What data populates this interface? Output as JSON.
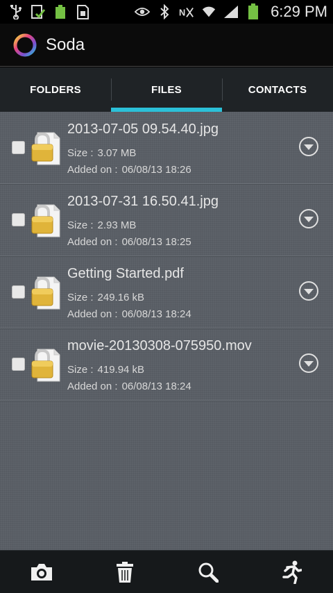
{
  "status_bar": {
    "time": "6:29 PM",
    "icons": [
      "usb-icon",
      "download-done-icon",
      "battery-app-icon",
      "sd-card-icon",
      "eye-icon",
      "bluetooth-icon",
      "no-signal-icon",
      "wifi-icon",
      "signal-icon",
      "battery-icon"
    ]
  },
  "app_bar": {
    "title": "Soda"
  },
  "tabs": [
    {
      "label": "FOLDERS"
    },
    {
      "label": "FILES"
    },
    {
      "label": "CONTACTS"
    }
  ],
  "labels": {
    "size": "Size :",
    "added": "Added on :"
  },
  "files": [
    {
      "name": "2013-07-05 09.54.40.jpg",
      "size": "3.07 MB",
      "added": "06/08/13 18:26"
    },
    {
      "name": "2013-07-31 16.50.41.jpg",
      "size": "2.93 MB",
      "added": "06/08/13 18:25"
    },
    {
      "name": "Getting Started.pdf",
      "size": "249.16 kB",
      "added": "06/08/13 18:24"
    },
    {
      "name": "movie-20130308-075950.mov",
      "size": "419.94 kB",
      "added": "06/08/13 18:24"
    }
  ],
  "colors": {
    "accent": "#2bc0d8",
    "battery": "#74c043",
    "lock": "#e0b43a"
  },
  "bottom_bar": [
    "camera-icon",
    "trash-icon",
    "search-icon",
    "exit-running-icon"
  ]
}
